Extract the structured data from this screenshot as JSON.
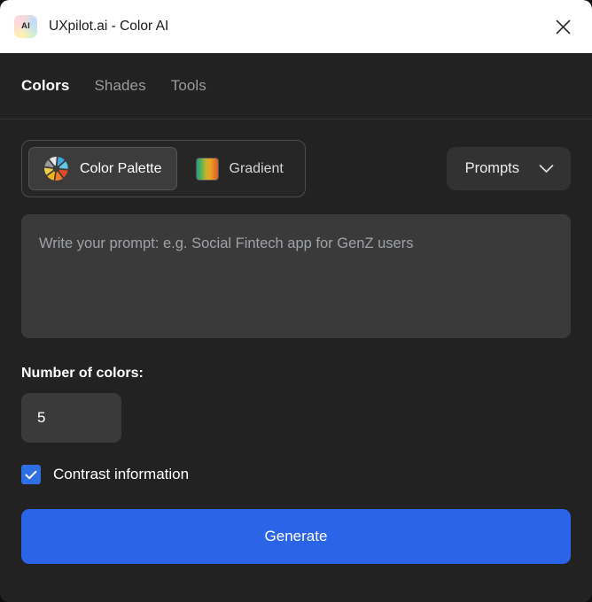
{
  "window": {
    "title": "UXpilot.ai - Color AI",
    "app_icon_label": "AI",
    "close_label": "Close"
  },
  "tabs": [
    {
      "label": "Colors",
      "active": true
    },
    {
      "label": "Shades",
      "active": false
    },
    {
      "label": "Tools",
      "active": false
    }
  ],
  "mode_switch": {
    "options": [
      {
        "label": "Color Palette",
        "icon": "color-wheel-icon",
        "active": true
      },
      {
        "label": "Gradient",
        "icon": "gradient-swatch-icon",
        "active": false
      }
    ]
  },
  "prompts_dropdown": {
    "label": "Prompts",
    "icon": "chevron-down-icon"
  },
  "prompt_input": {
    "placeholder": "Write your prompt: e.g. Social Fintech app for GenZ users",
    "value": ""
  },
  "number_of_colors": {
    "label": "Number of colors:",
    "value": "5"
  },
  "contrast": {
    "label": "Contrast information",
    "checked": true
  },
  "generate": {
    "label": "Generate"
  },
  "colors": {
    "titlebar_bg": "#ffffff",
    "body_bg": "#222222",
    "accent_blue": "#2c64e8",
    "checkbox_blue": "#2f6fe4",
    "input_bg": "#3a3a3a",
    "active_tab": "#ffffff",
    "inactive_tab": "#9b9b9b"
  }
}
